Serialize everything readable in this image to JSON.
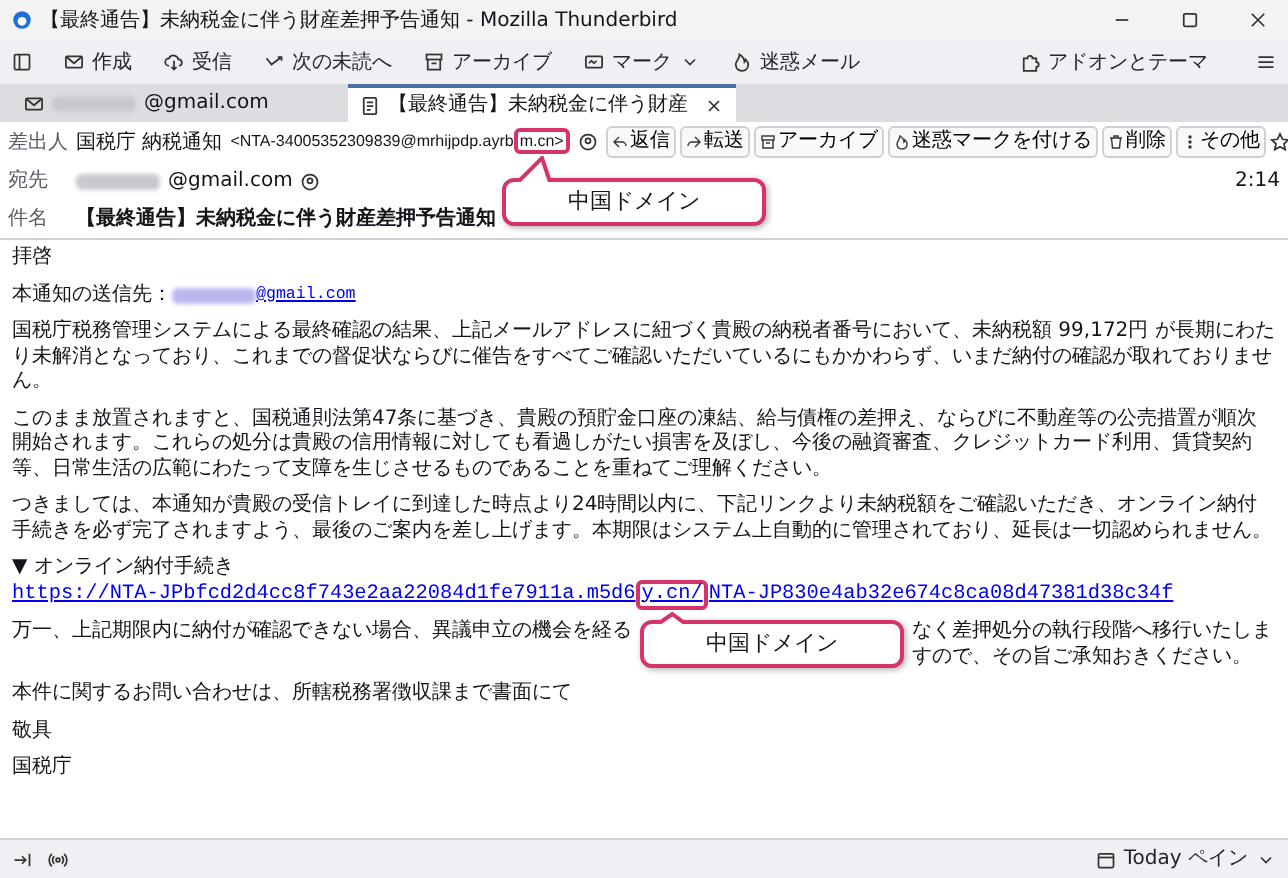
{
  "window": {
    "title": "【最終通告】未納税金に伴う財産差押予告通知 - Mozilla Thunderbird"
  },
  "toolbar": {
    "items": [
      {
        "kind": "compose",
        "label": "作成"
      },
      {
        "kind": "download",
        "label": "受信"
      },
      {
        "kind": "next",
        "label": "次の未読へ"
      },
      {
        "kind": "archive",
        "label": "アーカイブ"
      },
      {
        "kind": "mark",
        "label": "マーク"
      },
      {
        "kind": "junk",
        "label": "迷惑メール"
      }
    ],
    "addons": "アドオンとテーマ"
  },
  "tabs": [
    {
      "kind": "mail",
      "label": "@gmail.com",
      "redacted": true,
      "selected": false
    },
    {
      "kind": "message",
      "label": "【最終通告】未納税金に伴う財産",
      "redacted": false,
      "selected": true
    }
  ],
  "header": {
    "from_label": "差出人",
    "from_name": "国税庁 納税通知",
    "from_address": {
      "before": "<NTA-34005352309839@mrhijpdp.ayrb",
      "highlighted": "m.cn>"
    },
    "actions": [
      {
        "kind": "reply",
        "label": "返信"
      },
      {
        "kind": "forward",
        "label": "転送"
      },
      {
        "kind": "archive",
        "label": "アーカイブ"
      },
      {
        "kind": "junk",
        "label": "迷惑マークを付ける"
      },
      {
        "kind": "delete",
        "label": "削除"
      },
      {
        "kind": "more",
        "label": "その他"
      }
    ],
    "to_label": "宛先",
    "to": "@gmail.com",
    "to_redacted": true,
    "time": "2:14",
    "subject_label": "件名",
    "subject": "【最終通告】未納税金に伴う財産差押予告通知"
  },
  "body": {
    "greeting": "拝啓",
    "recipient_label": "本通知の送信先：",
    "recipient": "@gmail.com",
    "recipient_redacted": true,
    "paragraphs": [
      "国税庁税務管理システムによる最終確認の結果、上記メールアドレスに紐づく貴殿の納税者番号において、未納税額 99,172円 が長期にわたり未解消となっており、これまでの督促状ならびに催告をすべてご確認いただいているにもかかわらず、いまだ納付の確認が取れておりません。",
      "このまま放置されますと、国税通則法第47条に基づき、貴殿の預貯金口座の凍結、給与債権の差押え、ならびに不動産等の公売措置が順次開始されます。これらの処分は貴殿の信用情報に対しても看過しがたい損害を及ぼし、今後の融資審査、クレジットカード利用、賃貸契約等、日常生活の広範にわたって支障を生じさせるものであることを重ねてご理解ください。",
      "つきましては、本通知が貴殿の受信トレイに到達した時点より24時間以内に、下記リンクより未納税額をご確認いただき、オンライン納付手続きを必ず完了されますよう、最後のご案内を差し上げます。本期限はシステム上自動的に管理されており、延長は一切認められません。"
    ],
    "link_heading": "▼ オンライン納付手続き",
    "link": {
      "before": "https://NTA-JPbfcd2d4cc8f743e2aa22084d1fe7911a.m5d6",
      "highlighted": "y.cn/",
      "after": "NTA-JP830e4ab32e674c8ca08d47381d38c34f"
    },
    "warning_parts": [
      "万一、上記期限内に納付が確認できない場合、異議申立の機会を経る",
      "なく差押処分の執行段階へ移行いたしますので、その旨ご承知おきください。"
    ],
    "inquiry": "本件に関するお問い合わせは、所轄税務署徴収課まで書面にて",
    "closing": "敬具",
    "signature": "国税庁"
  },
  "annotations": [
    {
      "text": "中国ドメイン"
    },
    {
      "text": "中国ドメイン"
    }
  ],
  "status_bar": {
    "today_pane": "Today ペイン"
  }
}
